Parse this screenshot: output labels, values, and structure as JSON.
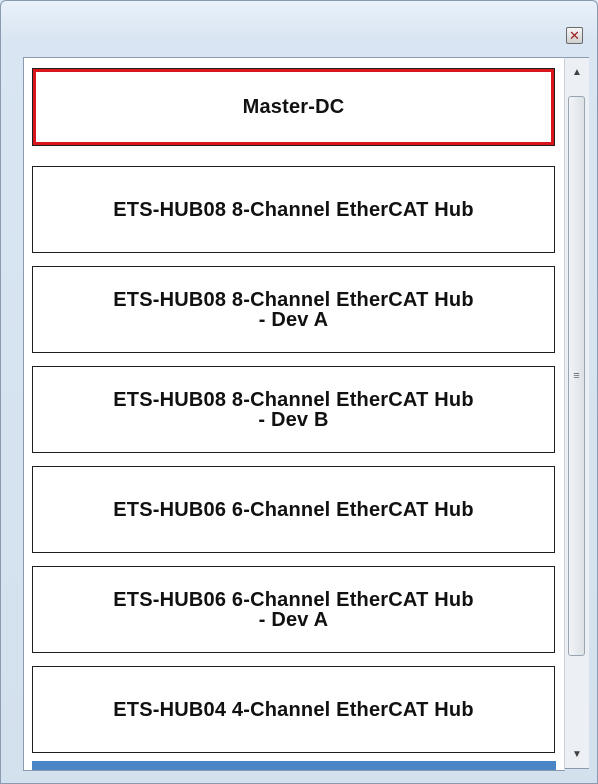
{
  "window": {
    "close_glyph": "✕"
  },
  "list": {
    "items": [
      {
        "label": "Master-DC",
        "selected": true
      },
      {
        "label": "ETS-HUB08 8-Channel EtherCAT Hub",
        "selected": false
      },
      {
        "label": "ETS-HUB08 8-Channel EtherCAT Hub\n- Dev A",
        "selected": false
      },
      {
        "label": "ETS-HUB08 8-Channel EtherCAT Hub\n- Dev B",
        "selected": false
      },
      {
        "label": "ETS-HUB06 6-Channel EtherCAT Hub",
        "selected": false
      },
      {
        "label": "ETS-HUB06 6-Channel EtherCAT Hub\n- Dev A",
        "selected": false
      },
      {
        "label": "ETS-HUB04 4-Channel EtherCAT Hub",
        "selected": false
      }
    ]
  },
  "scrollbar": {
    "up_glyph": "▲",
    "down_glyph": "▼",
    "grip_glyph": "≡"
  },
  "colors": {
    "selected_border": "#d8161c",
    "bottom_bar": "#4a86c5"
  }
}
